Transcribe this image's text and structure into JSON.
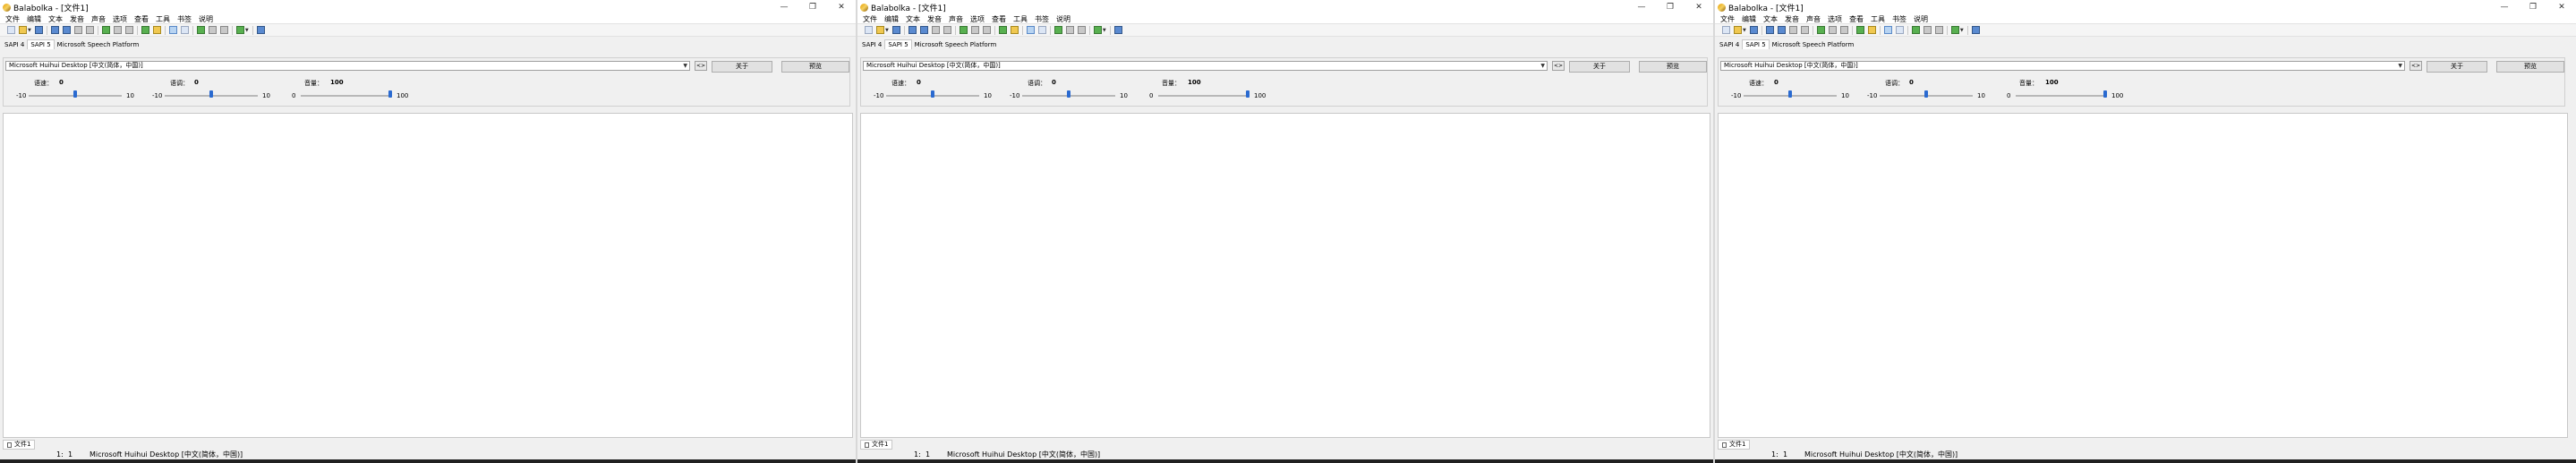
{
  "window": {
    "title": "Balabolka - [文件1]",
    "minimize_glyph": "—",
    "restore_glyph": "❐",
    "close_glyph": "✕"
  },
  "menu": [
    "文件",
    "编辑",
    "文本",
    "发音",
    "声音",
    "选项",
    "查看",
    "工具",
    "书签",
    "说明"
  ],
  "engine_tabs": [
    "SAPI 4",
    "SAPI 5",
    "Microsoft Speech Platform"
  ],
  "active_engine_tab": "SAPI 5",
  "voice": {
    "selected": "Microsoft Huihui Desktop [中文(简体，中国)]",
    "more_button": "<>"
  },
  "buttons": {
    "about": "关于",
    "preview": "预览"
  },
  "params": {
    "rate": {
      "label": "语速：",
      "value": "0",
      "min": "-10",
      "max": "10",
      "level_percent": 50
    },
    "pitch": {
      "label": "语调：",
      "value": "0",
      "min": "-10",
      "max": "10",
      "level_percent": 50
    },
    "volume": {
      "label": "音量：",
      "value": "100",
      "min": "0",
      "max": "100",
      "level_percent": 100
    }
  },
  "doc_tab": "文件1",
  "status": {
    "line": "1:",
    "col": "1",
    "voice": "Microsoft Huihui Desktop [中文(简体，中国)]"
  },
  "colors": {
    "accent": "#2a6ad0",
    "window_bg": "#f0f0f0"
  }
}
